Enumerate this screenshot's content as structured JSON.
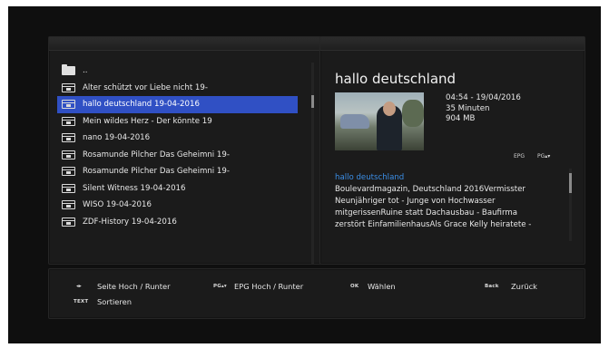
{
  "file_list": {
    "items": [
      {
        "type": "folder",
        "label": ".."
      },
      {
        "type": "recording",
        "label": "Alter schützt vor Liebe nicht 19-"
      },
      {
        "type": "recording",
        "label": "hallo deutschland 19-04-2016",
        "selected": true
      },
      {
        "type": "recording",
        "label": "Mein wildes Herz - Der könnte  19"
      },
      {
        "type": "recording",
        "label": "nano 19-04-2016"
      },
      {
        "type": "recording",
        "label": "Rosamunde Pilcher Das Geheimni 19-"
      },
      {
        "type": "recording",
        "label": "Rosamunde Pilcher Das Geheimni 19-"
      },
      {
        "type": "recording",
        "label": "Silent Witness 19-04-2016"
      },
      {
        "type": "recording",
        "label": "WISO 19-04-2016"
      },
      {
        "type": "recording",
        "label": "ZDF-History 19-04-2016"
      }
    ]
  },
  "detail": {
    "title": "hallo deutschland",
    "time": "04:54 - 19/04/2016",
    "duration": "35 Minuten",
    "size": "904 MB",
    "badge_epg": "EPG",
    "badge_pg": "PG▴▾",
    "desc_highlight": "hallo deutschland",
    "desc_lines": [
      "Boulevardmagazin, Deutschland 2016Vermisster",
      "Neunjähriger tot - Junge von Hochwasser",
      "mitgerissenRuine statt Dachausbau - Baufirma",
      "zerstört EinfamilienhausAls Grace Kelly heiratete -"
    ]
  },
  "help": {
    "key_lr": "◂▸",
    "page_label": "Seite Hoch / Runter",
    "key_pg": "PG▴▾",
    "epg_label": "EPG Hoch / Runter",
    "key_ok": "OK",
    "ok_label": "Wählen",
    "key_back": "Back",
    "back_label": "Zurück",
    "key_text": "TEXT",
    "text_label": "Sortieren"
  },
  "colors": {
    "selection": "#3050c4",
    "highlight_text": "#3b8ee6"
  }
}
